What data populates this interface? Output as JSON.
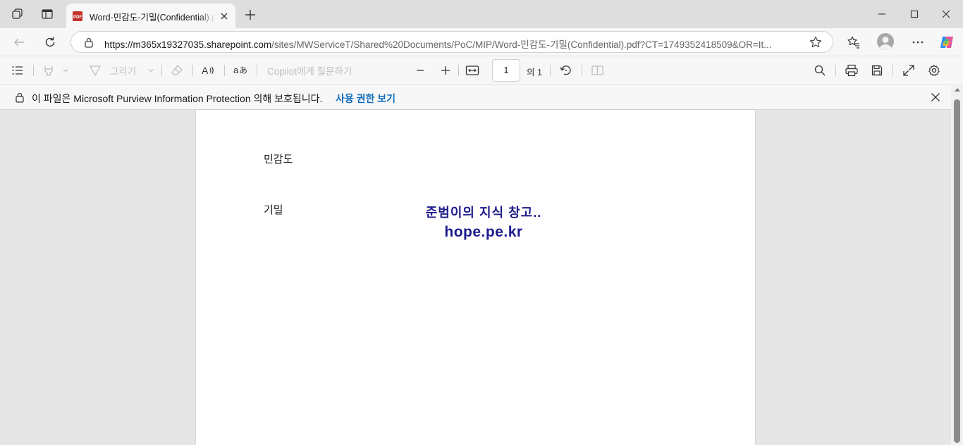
{
  "tab": {
    "title": "Word-민감도-기밀(Confidential).pdf"
  },
  "address": {
    "host": "https://m365x19327035.sharepoint.com",
    "path": "/sites/MWServiceT/Shared%20Documents/PoC/MIP/Word-민감도-기밀(Confidential).pdf?CT=1749352418509&OR=It..."
  },
  "pdf_toolbar": {
    "draw_label": "그리기",
    "copilot_placeholder": "Copilot에게 질문하기",
    "page_number": "1",
    "page_of": "의 1"
  },
  "infobar": {
    "text": "이 파일은 Microsoft Purview Information Protection 의해 보호됩니다.",
    "link": "사용 권한 보기"
  },
  "document": {
    "line1": "민감도",
    "line2": "기밀"
  },
  "watermark": {
    "line1": "준범이의 지식 창고..",
    "line2": "hope.pe.kr"
  },
  "colors": {
    "link": "#0f6cbd",
    "watermark": "#1d1a8c",
    "pdf_icon": "#c4322b"
  }
}
